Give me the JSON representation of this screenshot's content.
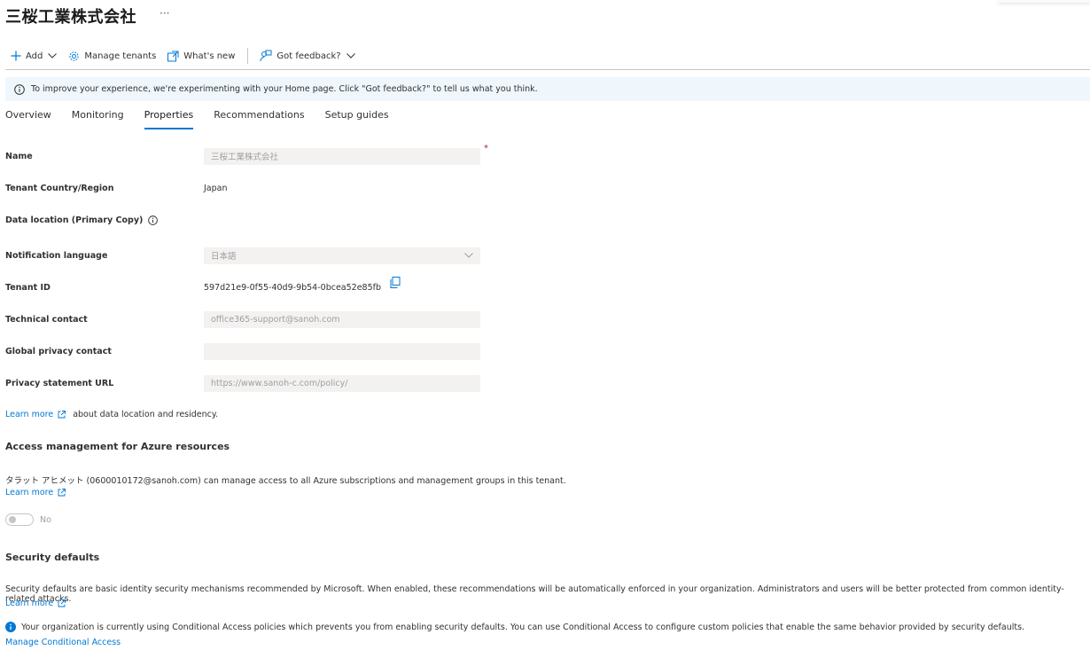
{
  "header": {
    "title": "三桜工業株式会社",
    "more_label": "···"
  },
  "toolbar": {
    "add_label": "Add",
    "manage_tenants_label": "Manage tenants",
    "whats_new_label": "What's new",
    "feedback_label": "Got feedback?"
  },
  "banner": {
    "text": "To improve your experience, we're experimenting with your Home page. Click \"Got feedback?\" to tell us what you think."
  },
  "tabs": [
    {
      "label": "Overview",
      "active": false
    },
    {
      "label": "Monitoring",
      "active": false
    },
    {
      "label": "Properties",
      "active": true
    },
    {
      "label": "Recommendations",
      "active": false
    },
    {
      "label": "Setup guides",
      "active": false
    }
  ],
  "properties": {
    "name": {
      "label": "Name",
      "value": "三桜工業株式会社",
      "required_mark": "*"
    },
    "country": {
      "label": "Tenant Country/Region",
      "value": "Japan"
    },
    "data_location": {
      "label": "Data location (Primary Copy)"
    },
    "notification_language": {
      "label": "Notification language",
      "value": "日本語"
    },
    "tenant_id": {
      "label": "Tenant ID",
      "value": "597d21e9-0f55-40d9-9b54-0bcea52e85fb"
    },
    "technical_contact": {
      "label": "Technical contact",
      "value": "office365-support@sanoh.com"
    },
    "privacy_contact": {
      "label": "Global privacy contact",
      "value": ""
    },
    "privacy_url": {
      "label": "Privacy statement URL",
      "value": "https://www.sanoh-c.com/policy/"
    }
  },
  "data_location_note": {
    "link_label": "Learn more",
    "text": "about data location and residency."
  },
  "access_management": {
    "title": "Access management for Azure resources",
    "description": "タラット アヒメット (0600010172@sanoh.com) can manage access to all Azure subscriptions and management groups in this tenant.",
    "link_label": "Learn more",
    "toggle_label": "No",
    "toggle_on": false
  },
  "security_defaults": {
    "title": "Security defaults",
    "description": "Security defaults are basic identity security mechanisms recommended by Microsoft. When enabled, these recommendations will be automatically enforced in your organization. Administrators and users will be better protected from common identity-related attacks.",
    "link_label": "Learn more",
    "info_text": "Your organization is currently using Conditional Access policies which prevents you from enabling security defaults. You can use Conditional Access to configure custom policies that enable the same behavior provided by security defaults.",
    "manage_link_label": "Manage Conditional Access"
  },
  "colors": {
    "accent": "#0078d4",
    "banner_bg": "#eff6fc",
    "field_bg": "#f3f2f1",
    "required": "#a4262c"
  }
}
